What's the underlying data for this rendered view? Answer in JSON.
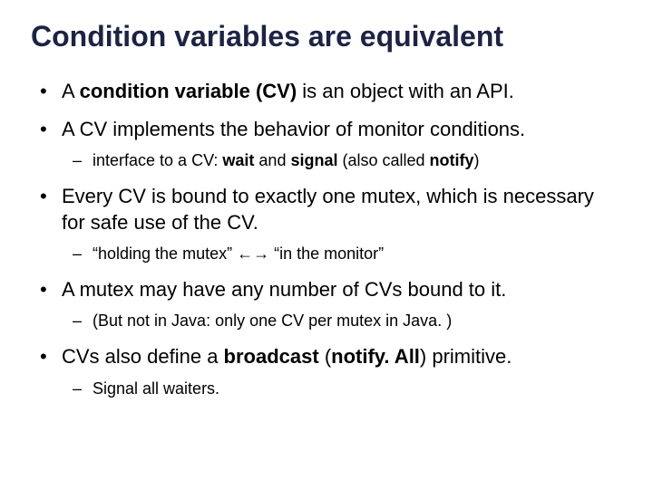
{
  "title": "Condition variables are equivalent",
  "b1_a": "A ",
  "b1_b": "condition variable (CV)",
  "b1_c": " is an object with an API.",
  "b2": "A CV implements the behavior of monitor conditions.",
  "b2s_a": "interface to a CV: ",
  "b2s_b": "wait",
  "b2s_c": " and ",
  "b2s_d": "signal",
  "b2s_e": " (also called ",
  "b2s_f": "notify",
  "b2s_g": ")",
  "b3": "Every CV is bound to exactly one mutex, which is necessary for safe use of the CV.",
  "b3s": "“holding the mutex” ←→ “in the monitor”",
  "b4": "A mutex may have any number of CVs bound to it.",
  "b4s": "(But not in Java: only one CV per mutex in Java. )",
  "b5_a": "CVs also define a ",
  "b5_b": "broadcast",
  "b5_c": " (",
  "b5_d": "notify. All",
  "b5_e": ") primitive.",
  "b5s": "Signal all waiters."
}
